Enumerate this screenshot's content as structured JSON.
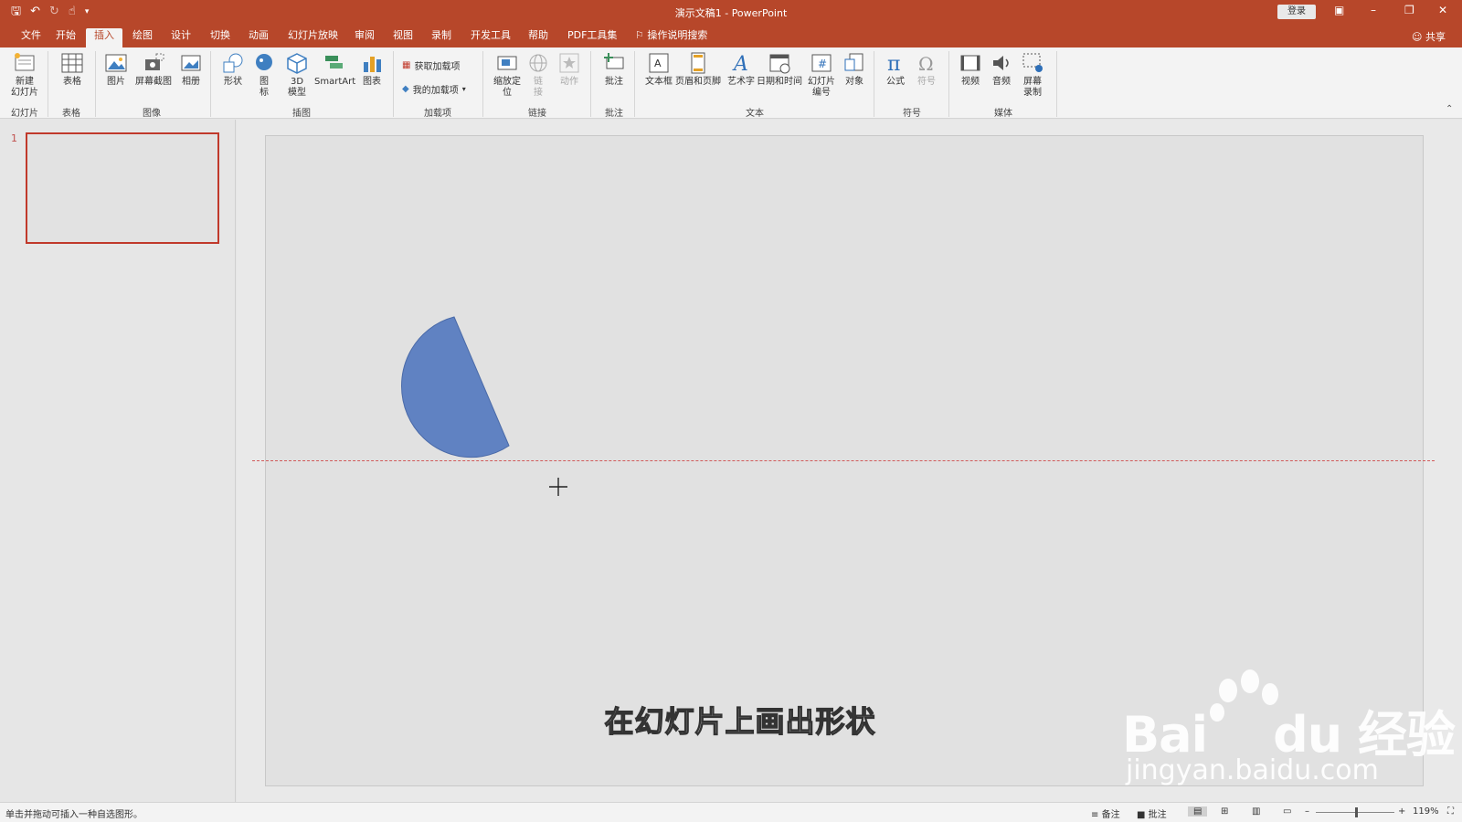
{
  "app": {
    "title": "演示文稿1 - PowerPoint",
    "login_label": "登录",
    "share_label": "共享",
    "accent": "#b7472a"
  },
  "tabs": [
    "文件",
    "开始",
    "插入",
    "绘图",
    "设计",
    "切换",
    "动画",
    "幻灯片放映",
    "审阅",
    "视图",
    "录制",
    "开发工具",
    "帮助",
    "PDF工具集"
  ],
  "active_tab": "插入",
  "tell_me": "操作说明搜索",
  "ribbon": {
    "new_slide": "新建\n幻灯片",
    "table": "表格",
    "picture": "图片",
    "screenshot": "屏幕截图",
    "album": "相册",
    "shapes": "形状",
    "icons": "图\n标",
    "model3d": "3D\n模型",
    "smartart": "SmartArt",
    "chart": "图表",
    "get_addins": "获取加载项",
    "my_addins": "我的加载项",
    "zoom": "缩放定\n位",
    "link": "链\n接",
    "action": "动作",
    "comment": "批注",
    "textbox": "文本框",
    "header_footer": "页眉和页脚",
    "wordart": "艺术字",
    "datetime": "日期和时间",
    "slide_number": "幻灯片\n编号",
    "object": "对象",
    "equation": "公式",
    "symbol": "符号",
    "video": "视频",
    "audio": "音频",
    "screen_recording": "屏幕\n录制",
    "groups": {
      "slides": "幻灯片",
      "tables": "表格",
      "images": "图像",
      "illustrations": "插图",
      "addins": "加载项",
      "links": "链接",
      "comments": "批注",
      "text": "文本",
      "symbols": "符号",
      "media": "媒体"
    }
  },
  "thumbnail": {
    "slide_number": "1"
  },
  "slide": {
    "caption": "在幻灯片上画出形状",
    "shape_color": "#6082c2"
  },
  "watermark": {
    "logo": "Bai du 经验",
    "url": "jingyan.baidu.com"
  },
  "status": {
    "message": "单击并拖动可插入一种自选图形。",
    "notes": "备注",
    "comments": "批注",
    "zoom": "119%"
  }
}
